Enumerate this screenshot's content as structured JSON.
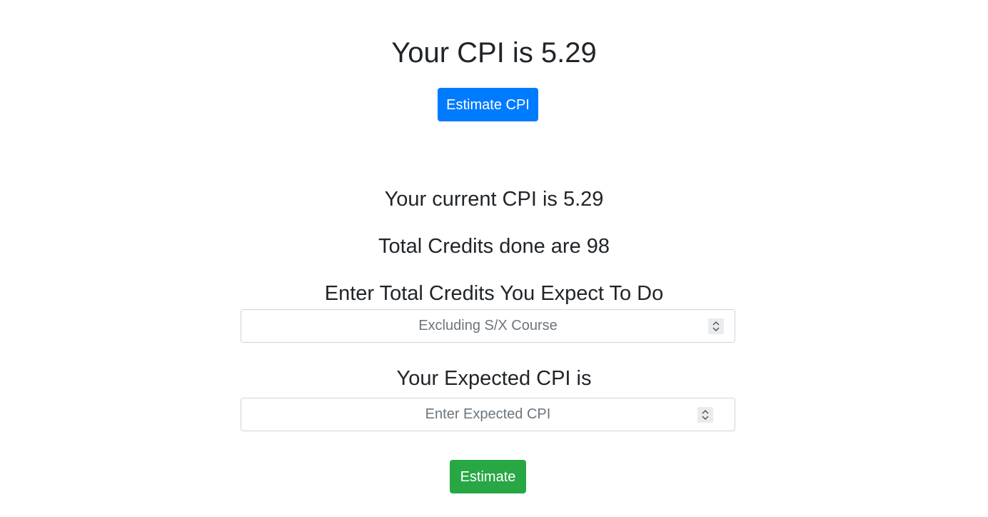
{
  "header": {
    "title": "Your CPI is 5.29",
    "estimate_cpi_button": "Estimate CPI"
  },
  "estimator": {
    "current_cpi_text": "Your current CPI is 5.29",
    "credits_done_text": "Total Credits done are 98",
    "total_credits_label": "Enter Total Credits You Expect To Do",
    "total_credits_placeholder": "Excluding S/X Course",
    "expected_cpi_label": "Your Expected CPI is",
    "expected_cpi_placeholder": "Enter Expected CPI",
    "estimate_button": "Estimate"
  },
  "colors": {
    "primary": "#007bff",
    "success": "#28a745"
  },
  "icons": {
    "spinner": "spinner-arrows-icon"
  }
}
